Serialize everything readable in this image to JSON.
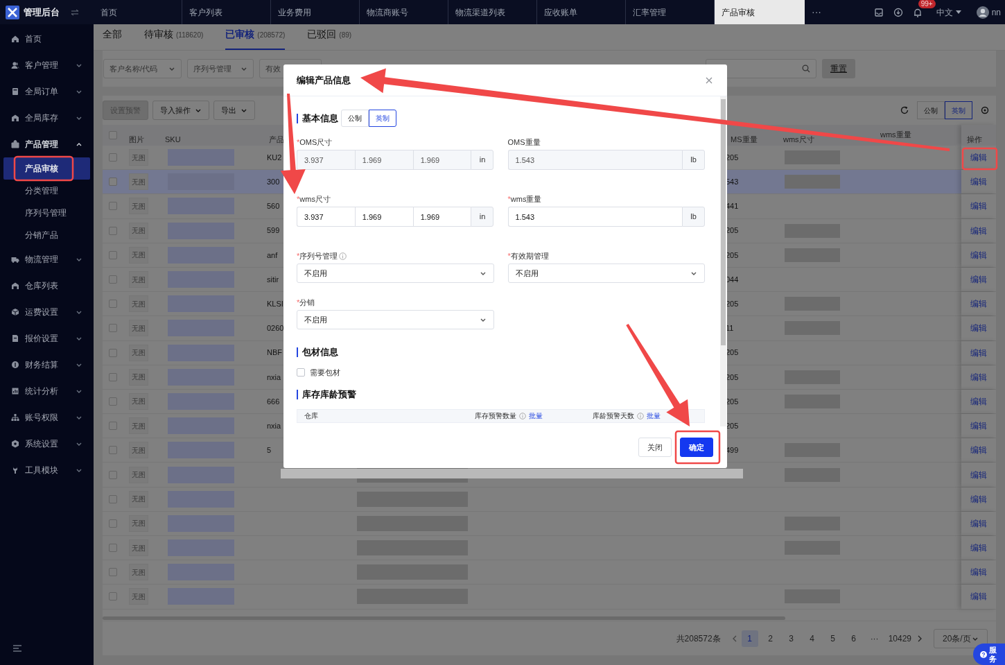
{
  "app": {
    "title": "管理后台"
  },
  "top_tabs": [
    {
      "label": "首页",
      "selected": false
    },
    {
      "label": "客户列表",
      "selected": false
    },
    {
      "label": "业务费用",
      "selected": false
    },
    {
      "label": "物流商账号",
      "selected": false
    },
    {
      "label": "物流渠道列表",
      "selected": false
    },
    {
      "label": "应收账单",
      "selected": false
    },
    {
      "label": "汇率管理",
      "selected": false
    },
    {
      "label": "产品审核",
      "selected": true
    }
  ],
  "top_more": "···",
  "header": {
    "notification_badge": "99+",
    "language": "中文",
    "user": "nn"
  },
  "sidebar": {
    "items": [
      {
        "label": "首页",
        "selected": false
      },
      {
        "label": "客户管理",
        "expanded": false,
        "selected": false
      },
      {
        "label": "全局订单",
        "expanded": false,
        "selected": false
      },
      {
        "label": "全局库存",
        "expanded": false,
        "selected": false
      },
      {
        "label": "产品管理",
        "expanded": true,
        "selected": false,
        "children": [
          {
            "label": "产品审核",
            "selected": true
          },
          {
            "label": "分类管理",
            "selected": false
          },
          {
            "label": "序列号管理",
            "selected": false
          },
          {
            "label": "分销产品",
            "selected": false
          }
        ]
      },
      {
        "label": "物流管理",
        "expanded": false,
        "selected": false
      },
      {
        "label": "仓库列表",
        "selected": false
      },
      {
        "label": "运费设置",
        "expanded": false,
        "selected": false
      },
      {
        "label": "报价设置",
        "expanded": false,
        "selected": false
      },
      {
        "label": "财务结算",
        "expanded": false,
        "selected": false
      },
      {
        "label": "统计分析",
        "expanded": false,
        "selected": false
      },
      {
        "label": "账号权限",
        "expanded": false,
        "selected": false
      },
      {
        "label": "系统设置",
        "expanded": false,
        "selected": false
      },
      {
        "label": "工具模块",
        "expanded": false,
        "selected": false
      }
    ]
  },
  "status_tabs": [
    {
      "label": "全部",
      "selected": false
    },
    {
      "label": "待审核",
      "count": "(118620)",
      "selected": false
    },
    {
      "label": "已审核",
      "count": "(208572)",
      "selected": true
    },
    {
      "label": "已驳回",
      "count": "(89)",
      "selected": false
    }
  ],
  "filters": {
    "selects": [
      "客户名称/代码",
      "序列号管理",
      "有效"
    ],
    "reset": "重置"
  },
  "toolbar": {
    "buttons": [
      {
        "label": "设置预警",
        "kind": "plain",
        "disabled": true
      },
      {
        "label": "导入操作",
        "kind": "dropdown",
        "disabled": false
      },
      {
        "label": "导出",
        "kind": "dropdown",
        "disabled": false
      }
    ],
    "units": [
      {
        "label": "公制",
        "selected": false
      },
      {
        "label": "英制",
        "selected": true
      }
    ]
  },
  "table": {
    "header_checked": false,
    "columns": [
      "图片",
      "SKU",
      "产品",
      "MS重量",
      "wms尺寸",
      "wms重量",
      "操作"
    ],
    "rows": [
      {
        "checked": false,
        "selected": false,
        "image": "无图",
        "product": "KU2",
        "oms_weight": "205",
        "action": "编辑"
      },
      {
        "checked": false,
        "selected": true,
        "image": "无图",
        "product": "300",
        "oms_weight": "543",
        "action": "编辑"
      },
      {
        "checked": false,
        "selected": false,
        "image": "无图",
        "product": "560",
        "oms_weight": "441",
        "action": "编辑"
      },
      {
        "checked": false,
        "selected": false,
        "image": "无图",
        "product": "599",
        "oms_weight": "205",
        "action": "编辑"
      },
      {
        "checked": false,
        "selected": false,
        "image": "无图",
        "product": "anf",
        "oms_weight": "205",
        "action": "编辑"
      },
      {
        "checked": false,
        "selected": false,
        "image": "无图",
        "product": "sitir",
        "oms_weight": "044",
        "action": "编辑"
      },
      {
        "checked": false,
        "selected": false,
        "image": "无图",
        "product": "KLSI",
        "oms_weight": "205",
        "action": "编辑"
      },
      {
        "checked": false,
        "selected": false,
        "image": "无图",
        "product": "0260",
        "oms_weight": "11",
        "action": "编辑"
      },
      {
        "checked": false,
        "selected": false,
        "image": "无图",
        "product": "NBF",
        "oms_weight": "205",
        "action": "编辑"
      },
      {
        "checked": false,
        "selected": false,
        "image": "无图",
        "product": "nxia",
        "oms_weight": "205",
        "action": "编辑"
      },
      {
        "checked": false,
        "selected": false,
        "image": "无图",
        "product": "666",
        "oms_weight": "205",
        "action": "编辑"
      },
      {
        "checked": false,
        "selected": false,
        "image": "无图",
        "product": "nxia",
        "oms_weight": "205",
        "action": "编辑"
      },
      {
        "checked": false,
        "selected": false,
        "image": "无图",
        "product": "5",
        "oms_weight": "499",
        "action": "编辑"
      },
      {
        "checked": false,
        "selected": false,
        "image": "无图",
        "action": "编辑"
      },
      {
        "checked": false,
        "selected": false,
        "image": "无图",
        "action": "编辑"
      },
      {
        "checked": false,
        "selected": false,
        "image": "无图",
        "action": "编辑"
      },
      {
        "checked": false,
        "selected": false,
        "image": "无图",
        "action": "编辑"
      },
      {
        "checked": false,
        "selected": false,
        "image": "无图",
        "action": "编辑"
      },
      {
        "checked": false,
        "selected": false,
        "image": "无图",
        "action": "编辑"
      }
    ]
  },
  "pagination": {
    "total": "共208572条",
    "pages": [
      {
        "label": "1",
        "selected": true
      },
      {
        "label": "2",
        "selected": false
      },
      {
        "label": "3",
        "selected": false
      },
      {
        "label": "4",
        "selected": false
      },
      {
        "label": "5",
        "selected": false
      },
      {
        "label": "6",
        "selected": false
      },
      {
        "label": "···",
        "selected": false
      },
      {
        "label": "10429",
        "selected": false
      }
    ],
    "page_size": "20条/页"
  },
  "service": "服务",
  "modal": {
    "title": "编辑产品信息",
    "sections": [
      {
        "title": "基本信息",
        "units": [
          {
            "label": "公制",
            "selected": false
          },
          {
            "label": "英制",
            "selected": true
          }
        ],
        "fields": [
          {
            "kind": "dimensions",
            "label": "OMS尺寸",
            "required_mark": "*",
            "disabled": true,
            "values": [
              "3.937",
              "1.969",
              "1.969"
            ],
            "unit": "in"
          },
          {
            "kind": "weight",
            "label": "OMS重量",
            "disabled": true,
            "values": [
              "1.543"
            ],
            "unit": "lb"
          },
          {
            "kind": "dimensions",
            "label": "wms尺寸",
            "required_mark": "*",
            "disabled": false,
            "values": [
              "3.937",
              "1.969",
              "1.969"
            ],
            "unit": "in"
          },
          {
            "kind": "weight",
            "label": "wms重量",
            "required_mark": "*",
            "disabled": false,
            "values": [
              "1.543"
            ],
            "unit": "lb"
          },
          {
            "kind": "select",
            "label": "序列号管理",
            "required_mark": "*",
            "info": true,
            "value": "不启用"
          },
          {
            "kind": "select",
            "label": "有效期管理",
            "required_mark": "*",
            "value": "不启用"
          },
          {
            "kind": "select",
            "label": "分销",
            "required_mark": "*",
            "value": "不启用"
          }
        ]
      },
      {
        "title": "包材信息",
        "checkbox": {
          "label": "需要包材",
          "checked": false
        }
      },
      {
        "title": "库存库龄预警",
        "table_columns": [
          {
            "label": "仓库"
          },
          {
            "label": "库存预警数量",
            "link": "批量"
          },
          {
            "label": "库龄预警天数",
            "link": "批量"
          }
        ]
      }
    ],
    "buttons": [
      {
        "label": "关闭",
        "kind": "secondary"
      },
      {
        "label": "确定",
        "kind": "primary"
      }
    ]
  }
}
